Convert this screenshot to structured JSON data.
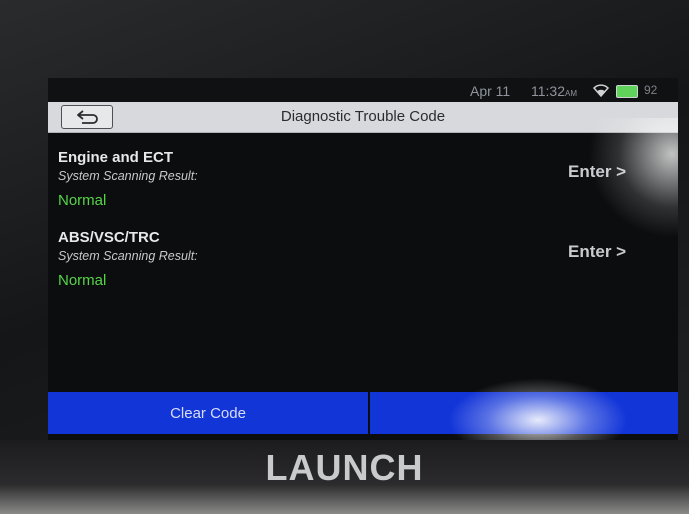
{
  "status_bar": {
    "date": "Apr 11",
    "time": "11:32",
    "ampm": "AM",
    "extra": "92"
  },
  "header": {
    "title": "Diagnostic Trouble Code"
  },
  "systems": [
    {
      "name": "Engine and ECT",
      "result_label": "System Scanning Result:",
      "result_value": "Normal",
      "enter_label": "Enter >"
    },
    {
      "name": "ABS/VSC/TRC",
      "result_label": "System Scanning Result:",
      "result_value": "Normal",
      "enter_label": "Enter >"
    }
  ],
  "footer": {
    "clear_code_label": "Clear Code",
    "right_button_label": ""
  },
  "device": {
    "brand": "LAUNCH"
  },
  "colors": {
    "accent_blue": "#1235d8",
    "normal_green": "#56d548",
    "title_bar": "#d7d9dc"
  },
  "icons": {
    "back": "back-arrow-icon",
    "wifi": "wifi-icon",
    "battery": "battery-icon"
  }
}
